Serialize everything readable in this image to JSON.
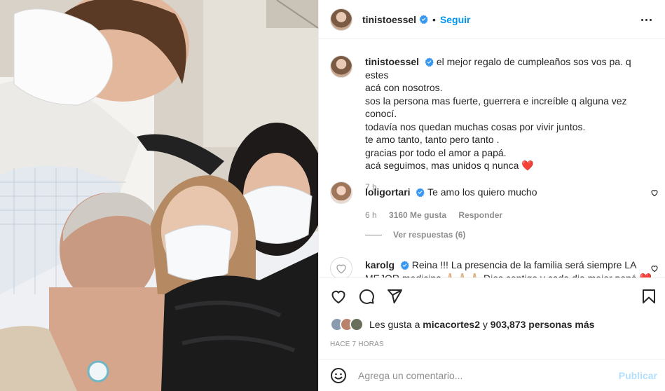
{
  "post": {
    "username": "tinistoessel",
    "follow_label": "Seguir",
    "separator": "•"
  },
  "caption": {
    "username": "tinistoessel",
    "lines": [
      "el mejor regalo de cumpleaños sos vos pa. q estes",
      "acá con nosotros.",
      "sos la persona mas fuerte, guerrera e increíble q alguna vez conocí.",
      "todavía nos quedan muchas cosas por vivir juntos.",
      "te amo tanto, tanto pero tanto .",
      "gracias por todo el amor a papá.",
      "acá seguimos, mas unidos q nunca ❤️"
    ],
    "time": "7 h"
  },
  "comments": [
    {
      "username": "loligortari",
      "text": "Te amo los quiero mucho",
      "time": "6 h",
      "likes": "3160 Me gusta",
      "reply_label": "Responder",
      "view_replies": "Ver respuestas (6)"
    },
    {
      "username": "karolg",
      "text": "Reina !!! La presencia de la familia será siempre LA",
      "text_cont": "MEJOR medicina 🙏🏻🙏🏻🙏🏻 Dios contigo y cada dia mejor papá ❤️"
    }
  ],
  "likes": {
    "prefix": "Les gusta a",
    "user": "micacortes2",
    "joiner": "y",
    "count": "903,873 personas más"
  },
  "timestamp": "HACE 7 HORAS",
  "add_comment": {
    "placeholder": "Agrega un comentario...",
    "publish_label": "Publicar"
  },
  "icons": {
    "verified": "verified-badge-icon",
    "more": "more-options-icon",
    "like": "heart-icon",
    "comment": "comment-icon",
    "share": "paper-plane-icon",
    "save": "bookmark-icon",
    "emoji": "emoji-icon"
  },
  "colors": {
    "link": "#0095f6",
    "verified": "#3897f0",
    "muted": "#8e8e8e",
    "publish_disabled": "#b2dffc"
  }
}
